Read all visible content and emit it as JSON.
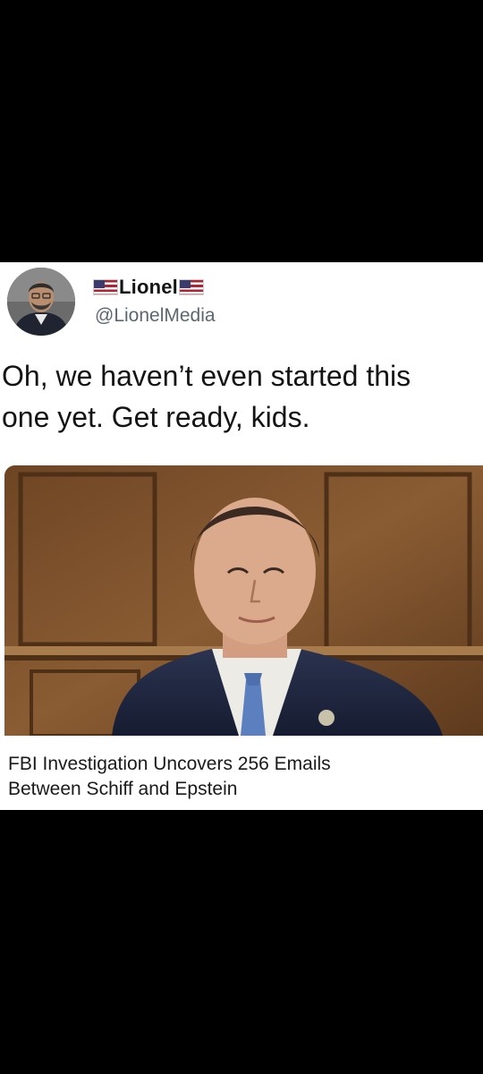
{
  "tweet": {
    "author": {
      "display_name": "Lionel",
      "handle": "@LionelMedia",
      "name_decorations": [
        "us-flag-icon",
        "us-flag-icon"
      ]
    },
    "text": "Oh, we haven’t even started this\none yet. Get ready, kids."
  },
  "link_card": {
    "headline": "FBI Investigation Uncovers 256 Emails\nBetween Schiff and Epstein"
  },
  "colors": {
    "background": "#000000",
    "card": "#ffffff",
    "text": "#141414",
    "handle": "#5b6770"
  }
}
